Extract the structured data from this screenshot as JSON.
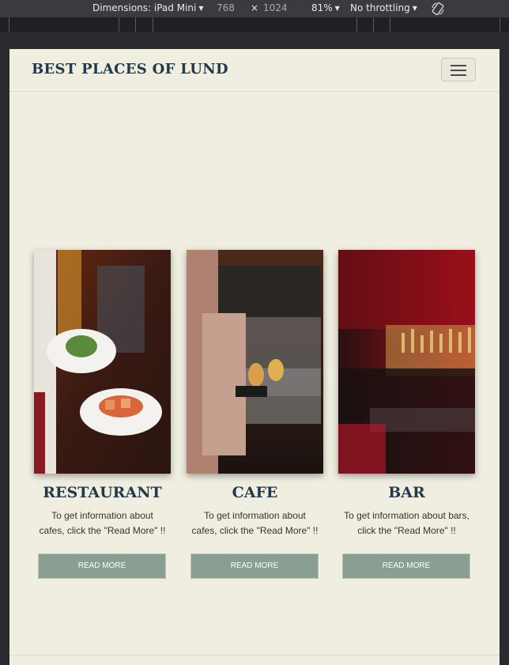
{
  "devtools": {
    "dimensions_label": "Dimensions: iPad Mini",
    "width_value": "768",
    "times_sign": "×",
    "height_value": "1024",
    "zoom": "81%",
    "throttling": "No throttling",
    "rotate_icon": "rotate-device-icon"
  },
  "navbar": {
    "brand": "BEST PLACES OF LUND",
    "toggler_icon": "hamburger-menu-icon"
  },
  "cards": [
    {
      "title": "RESTAURANT",
      "description": "To get information about cafes, click the \"Read More\" !!",
      "button": "READ MORE",
      "image": "restaurant-photo"
    },
    {
      "title": "CAFE",
      "description": "To get information about cafes, click the \"Read More\" !!",
      "button": "READ MORE",
      "image": "cafe-photo"
    },
    {
      "title": "BAR",
      "description": "To get information about bars, click the \"Read More\" !!",
      "button": "READ MORE",
      "image": "bar-photo"
    }
  ]
}
